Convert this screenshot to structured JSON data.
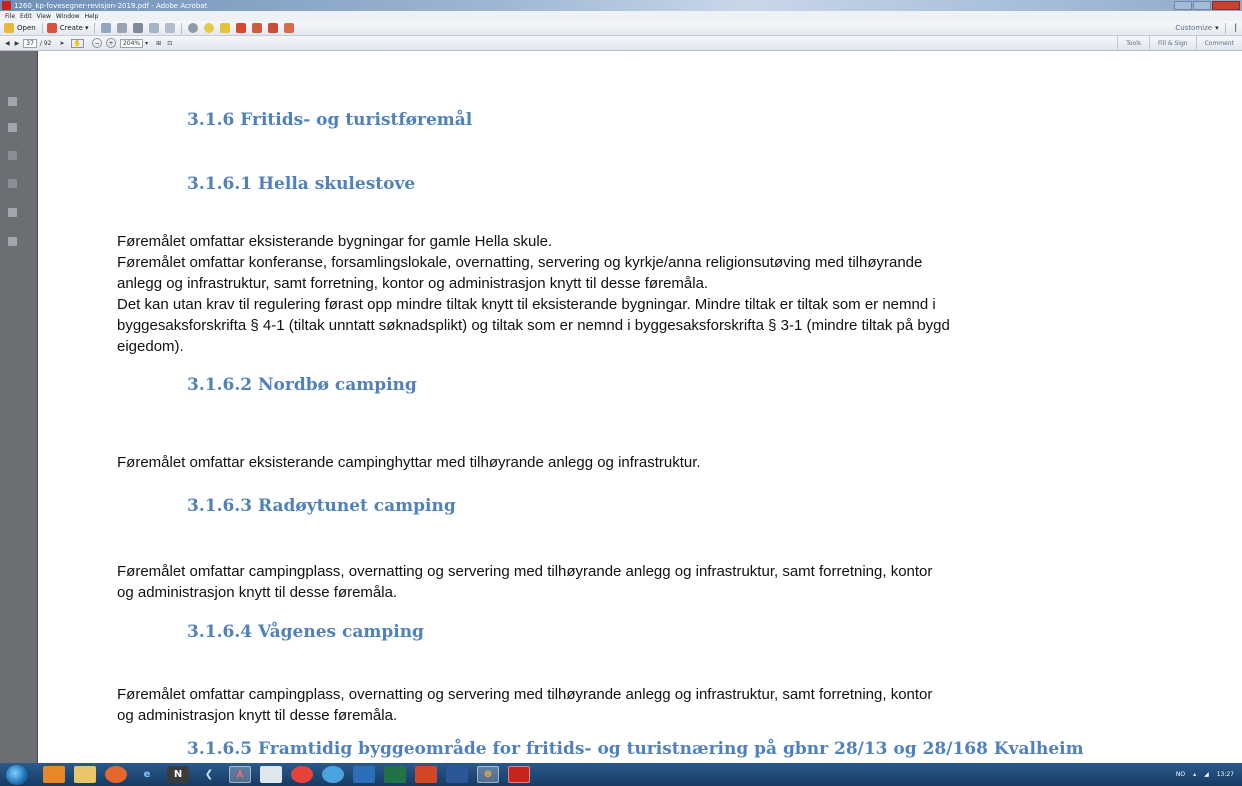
{
  "window": {
    "title": "1260_kp-fovesegner-revisjon-2019.pdf - Adobe Acrobat"
  },
  "menu": [
    "File",
    "Edit",
    "View",
    "Window",
    "Help"
  ],
  "toolbar": {
    "open_label": "Open",
    "create_label": "Create",
    "customize_label": "Customize"
  },
  "nav": {
    "page_current": "37",
    "page_total": "/ 92",
    "zoom": "204%",
    "right_tabs": [
      "Tools",
      "Fill & Sign",
      "Comment"
    ]
  },
  "document": {
    "headings": {
      "h316": "3.1.6    Fritids- og turistføremål",
      "h3161": "3.1.6.1 Hella skulestove",
      "h3162": "3.1.6.2 Nordbø camping",
      "h3163": "3.1.6.3 Radøytunet camping",
      "h3164": "3.1.6.4 Vågenes camping",
      "h3165": "3.1.6.5 Framtidig byggeområde for fritids- og turistnæring på gbnr 28/13 og 28/168 Kvalheim"
    },
    "hella": [
      "Føremålet omfattar eksisterande bygningar for gamle Hella skule.",
      "Føremålet omfattar konferanse, forsamlingslokale, overnatting, servering og kyrkje/anna religionsutøving med tilhøyrande",
      "anlegg og infrastruktur, samt forretning, kontor og administrasjon knytt til desse føremåla.",
      "Det kan utan krav til regulering førast opp mindre tiltak knytt til eksisterande bygningar. Mindre tiltak er tiltak som er nemnd i",
      "byggesaksforskrifta § 4-1 (tiltak unntatt søknadsplikt) og tiltak som er nemnd i byggesaksforskrifta § 3-1 (mindre tiltak på bygd",
      "eigedom)."
    ],
    "nordbo": [
      "Føremålet omfattar eksisterande campinghyttar med tilhøyrande anlegg og infrastruktur."
    ],
    "radoy": [
      "Føremålet omfattar campingplass, overnatting og servering med tilhøyrande anlegg og infrastruktur, samt forretning, kontor",
      "og administrasjon knytt til desse føremåla."
    ],
    "vagenes": [
      "Føremålet omfattar campingplass, overnatting og servering med tilhøyrande anlegg og infrastruktur, samt forretning, kontor",
      "og administrasjon knytt til desse føremåla."
    ]
  },
  "taskbar": {
    "lang": "NO",
    "time": "13:27"
  },
  "colors": {
    "heading": "#4f81bd",
    "taskbar": "#1f4a78"
  }
}
